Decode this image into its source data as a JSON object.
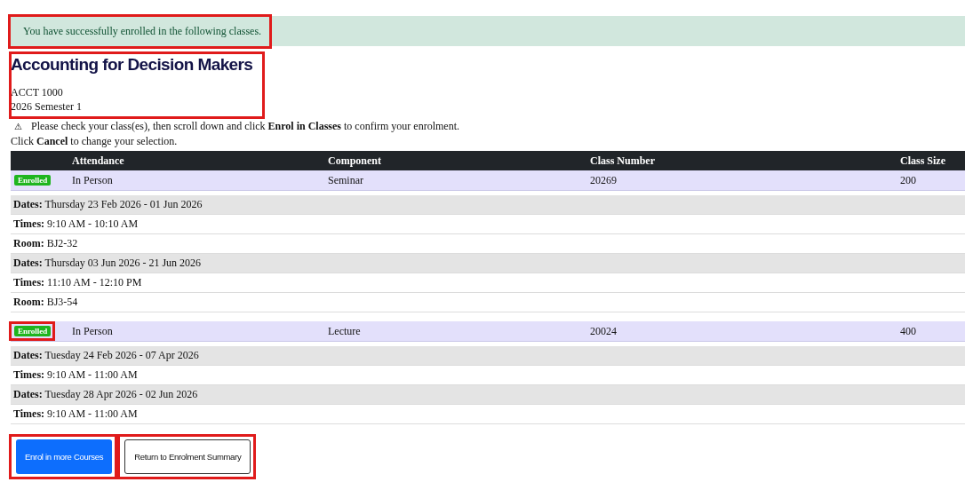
{
  "banner": {
    "message": "You have successfully enrolled in the following classes.",
    "highlighted": true
  },
  "course": {
    "title": "Accounting for Decision Makers",
    "code": "ACCT 1000",
    "term": "2026 Semester 1",
    "highlighted": true
  },
  "notice": {
    "icon": "⚠",
    "lines": [
      "Please check your class(es), then scroll down and click **Enrol in Classes** to confirm your enrolment.",
      "Click **Cancel** to change your selection."
    ]
  },
  "table": {
    "columns": [
      "Attendance",
      "Component",
      "Class Number",
      "Class Size"
    ]
  },
  "classes": [
    {
      "status": "Enrolled",
      "status_highlighted": false,
      "attendance": "In Person",
      "component": "Seminar",
      "class_number": "20269",
      "class_size": "200",
      "details": [
        {
          "kind": "dates",
          "label": "Dates:",
          "value": "Thursday 23 Feb 2026 - 01 Jun 2026"
        },
        {
          "kind": "times",
          "label": "Times:",
          "value": "9:10 AM - 10:10 AM"
        },
        {
          "kind": "room",
          "label": "Room:",
          "value": "BJ2-32"
        },
        {
          "kind": "dates",
          "label": "Dates:",
          "value": "Thursday 03 Jun 2026 - 21 Jun 2026"
        },
        {
          "kind": "times",
          "label": "Times:",
          "value": "11:10 AM - 12:10 PM"
        },
        {
          "kind": "room",
          "label": "Room:",
          "value": "BJ3-54"
        }
      ]
    },
    {
      "status": "Enrolled",
      "status_highlighted": true,
      "attendance": "In Person",
      "component": "Lecture",
      "class_number": "20024",
      "class_size": "400",
      "details": [
        {
          "kind": "dates",
          "label": "Dates:",
          "value": "Tuesday 24 Feb 2026 - 07 Apr 2026"
        },
        {
          "kind": "times",
          "label": "Times:",
          "value": "9:10 AM - 11:00 AM"
        },
        {
          "kind": "dates",
          "label": "Dates:",
          "value": "Tuesday 28 Apr 2026 - 02 Jun 2026"
        },
        {
          "kind": "times",
          "label": "Times:",
          "value": "9:10 AM - 11:00 AM"
        }
      ]
    }
  ],
  "buttons": [
    {
      "label": "Enrol in more Courses",
      "kind": "primary",
      "highlighted": true
    },
    {
      "label": "Return to Enrolment Summary",
      "kind": "secondary",
      "highlighted": true
    }
  ]
}
